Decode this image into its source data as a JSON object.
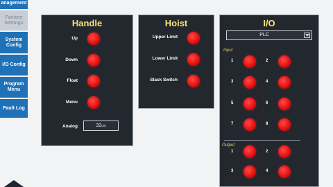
{
  "sidebar": {
    "items": [
      {
        "label": "anagement",
        "state": "active"
      },
      {
        "label": "Factory Settings",
        "state": "disabled"
      },
      {
        "label": "System Config",
        "state": "active"
      },
      {
        "label": "I/O Config",
        "state": "active"
      },
      {
        "label": "Program Menu",
        "state": "active"
      },
      {
        "label": "Fault Log",
        "state": "active"
      }
    ]
  },
  "handle": {
    "title": "Handle",
    "rows": [
      {
        "label": "Up",
        "indicator": "red"
      },
      {
        "label": "Down",
        "indicator": "red"
      },
      {
        "label": "Float",
        "indicator": "red"
      },
      {
        "label": "Menu",
        "indicator": "red"
      }
    ],
    "analog_label": "Analog",
    "analog_value": "32",
    "analog_unit": "cm"
  },
  "hoist": {
    "title": "Hoist",
    "rows": [
      {
        "label": "Upper Limit",
        "indicator": "red"
      },
      {
        "label": "Lower Limit",
        "indicator": "red"
      },
      {
        "label": "Slack Switch",
        "indicator": "red"
      }
    ]
  },
  "io": {
    "title": "I/O",
    "selected_source": "PLC",
    "input_label": "Input",
    "inputs": [
      {
        "num": "1",
        "indicator": "red"
      },
      {
        "num": "2",
        "indicator": "red"
      },
      {
        "num": "3",
        "indicator": "red"
      },
      {
        "num": "4",
        "indicator": "red"
      },
      {
        "num": "5",
        "indicator": "red"
      },
      {
        "num": "6",
        "indicator": "red"
      },
      {
        "num": "7",
        "indicator": "red"
      },
      {
        "num": "8",
        "indicator": "red"
      }
    ],
    "output_label": "Output",
    "outputs": [
      {
        "num": "1",
        "indicator": "red"
      },
      {
        "num": "2",
        "indicator": "red"
      },
      {
        "num": "3",
        "indicator": "red"
      },
      {
        "num": "4",
        "indicator": "red"
      }
    ]
  },
  "colors": {
    "panel_bg": "#23272e",
    "title_yellow": "#f4e779",
    "sidebar_blue": "#1f72b8",
    "indicator_red": "#e61212"
  }
}
